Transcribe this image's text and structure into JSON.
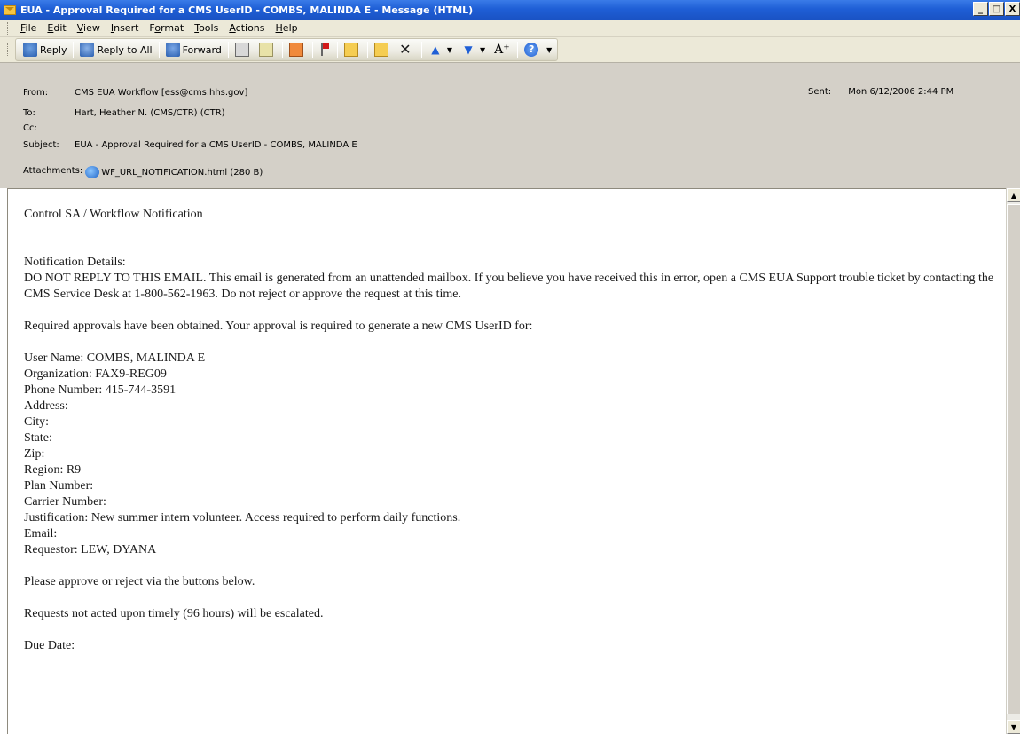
{
  "window": {
    "title": "EUA - Approval Required for a CMS UserID - COMBS, MALINDA E - Message (HTML)",
    "controls": [
      "_",
      "□",
      "X"
    ]
  },
  "menu": [
    {
      "label": "File",
      "key": "F",
      "rest": "ile"
    },
    {
      "label": "Edit",
      "key": "E",
      "rest": "dit"
    },
    {
      "label": "View",
      "key": "V",
      "rest": "iew"
    },
    {
      "label": "Insert",
      "key": "I",
      "rest": "nsert"
    },
    {
      "label": "Format",
      "key": "o",
      "pre": "F",
      "rest": "rmat"
    },
    {
      "label": "Tools",
      "key": "T",
      "rest": "ools"
    },
    {
      "label": "Actions",
      "key": "A",
      "rest": "ctions"
    },
    {
      "label": "Help",
      "key": "H",
      "rest": "elp"
    }
  ],
  "toolbar": {
    "reply": "Reply",
    "reply_all": "Reply to All",
    "forward": "Forward",
    "font_glyph": "A⁺",
    "help_glyph": "?"
  },
  "header": {
    "from_label": "From:",
    "from": "CMS EUA Workflow [ess@cms.hhs.gov]",
    "to_label": "To:",
    "to": "Hart, Heather N. (CMS/CTR) (CTR)",
    "cc_label": "Cc:",
    "cc": "",
    "subject_label": "Subject:",
    "subject": "EUA - Approval Required for a CMS UserID - COMBS, MALINDA E",
    "attachments_label": "Attachments:",
    "attachment": "WF_URL_NOTIFICATION.html (280 B)",
    "sent_label": "Sent:",
    "sent": "Mon 6/12/2006 2:44 PM"
  },
  "body": {
    "heading": "Control SA / Workflow Notification",
    "details_label": "Notification Details:",
    "warning": "DO NOT REPLY TO THIS EMAIL. This email is generated from an unattended mailbox. If you believe you have received this in error, open a CMS EUA Support trouble ticket by contacting the CMS Service Desk at 1-800-562-1963. Do not reject or approve the request at this time.",
    "required": "Required approvals have been obtained. Your approval is required to generate a new CMS UserID for:",
    "fields": [
      "User Name: COMBS, MALINDA E",
      "Organization: FAX9-REG09",
      "Phone Number: 415-744-3591",
      "Address:",
      "City:",
      "State:",
      "Zip:",
      "Region: R9",
      "Plan Number:",
      "Carrier Number:",
      "Justification: New summer intern volunteer. Access required to perform daily functions.",
      "Email:",
      "Requestor: LEW, DYANA"
    ],
    "please": "Please approve or reject via the buttons below.",
    "escalate": "Requests not acted upon timely (96 hours) will be escalated.",
    "due": "Due Date:"
  }
}
